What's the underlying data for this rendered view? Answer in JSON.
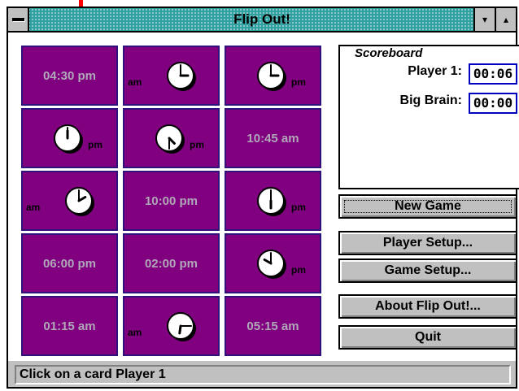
{
  "window": {
    "title": "Flip Out!"
  },
  "controls": {
    "minimize": "▾",
    "maximize": "▴"
  },
  "cards": [
    {
      "text": "04:30 pm"
    },
    {
      "clock": "3:00",
      "ampm": "am"
    },
    {
      "clock": "3:00",
      "ampm": "pm"
    },
    {
      "clock": "12:00",
      "ampm": "pm"
    },
    {
      "clock": "4:30",
      "ampm": "pm"
    },
    {
      "text": "10:45 am"
    },
    {
      "clock": "2:00",
      "ampm": "am"
    },
    {
      "text": "10:00 pm"
    },
    {
      "clock": "6:00",
      "ampm": "pm"
    },
    {
      "text": "06:00 pm"
    },
    {
      "text": "02:00 pm"
    },
    {
      "clock": "10:00",
      "ampm": "pm"
    },
    {
      "text": "01:15 am"
    },
    {
      "clock": "6:15",
      "ampm": "am"
    },
    {
      "text": "05:15 am"
    }
  ],
  "scoreboard": {
    "title": "Scoreboard",
    "players": [
      {
        "name": "Player 1:",
        "time": "00:06"
      },
      {
        "name": "Big Brain:",
        "time": "00:00"
      }
    ]
  },
  "buttons": [
    "New Game",
    "Player Setup...",
    "Game Setup...",
    "About Flip Out!...",
    "Quit"
  ],
  "status": "Click on a card Player 1",
  "colors": {
    "card": "#800080",
    "titlebar": "#30a0a0",
    "frame": "#c0c0c0"
  }
}
